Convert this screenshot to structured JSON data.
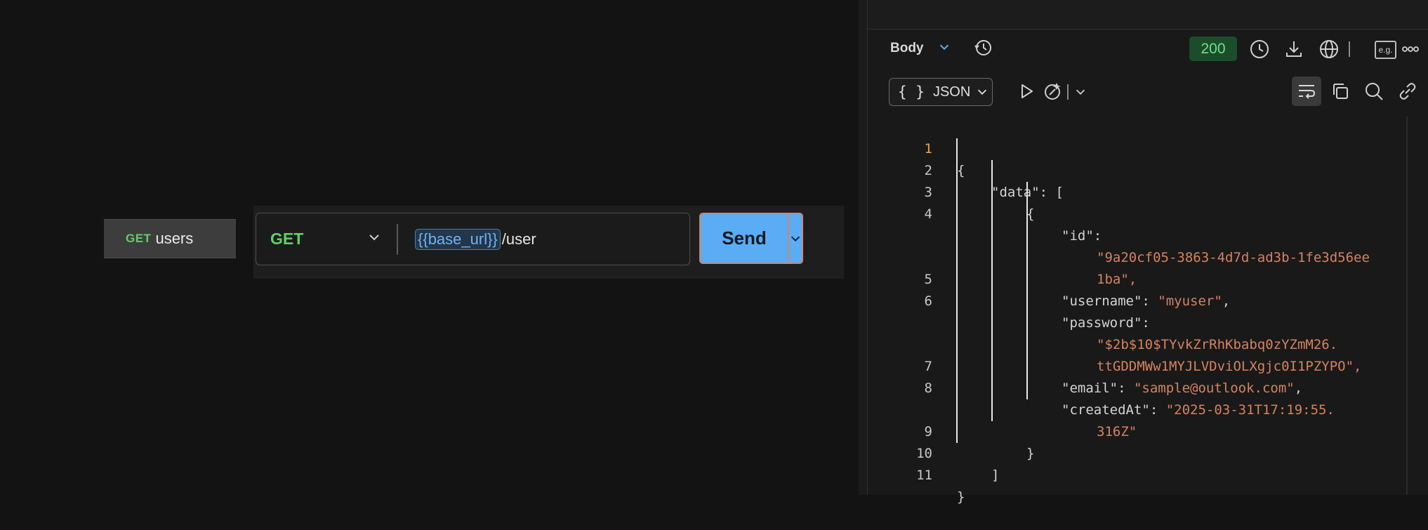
{
  "request_tab": {
    "method": "GET",
    "name": "users"
  },
  "url_bar": {
    "method": "GET",
    "variable": "{{base_url}}",
    "path": "/user",
    "send_label": "Send"
  },
  "response": {
    "section_label": "Body",
    "status_code": "200",
    "example_label": "e.g.",
    "format_brace": "{ }",
    "format_label": "JSON",
    "lines": [
      {
        "n": "1",
        "t": "{"
      },
      {
        "n": "2",
        "t": "\"data\": ["
      },
      {
        "n": "3",
        "t": "{"
      },
      {
        "n": "4",
        "t": "\"id\":"
      },
      {
        "n": "",
        "t": "\"9a20cf05-3863-4d7d-ad3b-1fe3d56ee"
      },
      {
        "n": "",
        "t": "1ba\","
      },
      {
        "n": "5",
        "t": "\"username\": \"myuser\","
      },
      {
        "n": "6",
        "t": "\"password\":"
      },
      {
        "n": "",
        "t": "\"$2b$10$TYvkZrRhKbabq0zYZmM26."
      },
      {
        "n": "",
        "t": "ttGDDMWw1MYJLVDviOLXgjc0I1PZYPO\","
      },
      {
        "n": "7",
        "t": "\"email\": \"sample@outlook.com\","
      },
      {
        "n": "8",
        "t": "\"createdAt\": \"2025-03-31T17:19:55."
      },
      {
        "n": "",
        "t": "316Z\""
      },
      {
        "n": "9",
        "t": "}"
      },
      {
        "n": "10",
        "t": "]"
      },
      {
        "n": "11",
        "t": "}"
      }
    ]
  },
  "colors": {
    "method_get": "#5fd068",
    "send_button": "#5aacf5",
    "status_ok_bg": "#1c4d2a",
    "json_string": "#d5835f",
    "active_line_number": "#f0a04b"
  }
}
